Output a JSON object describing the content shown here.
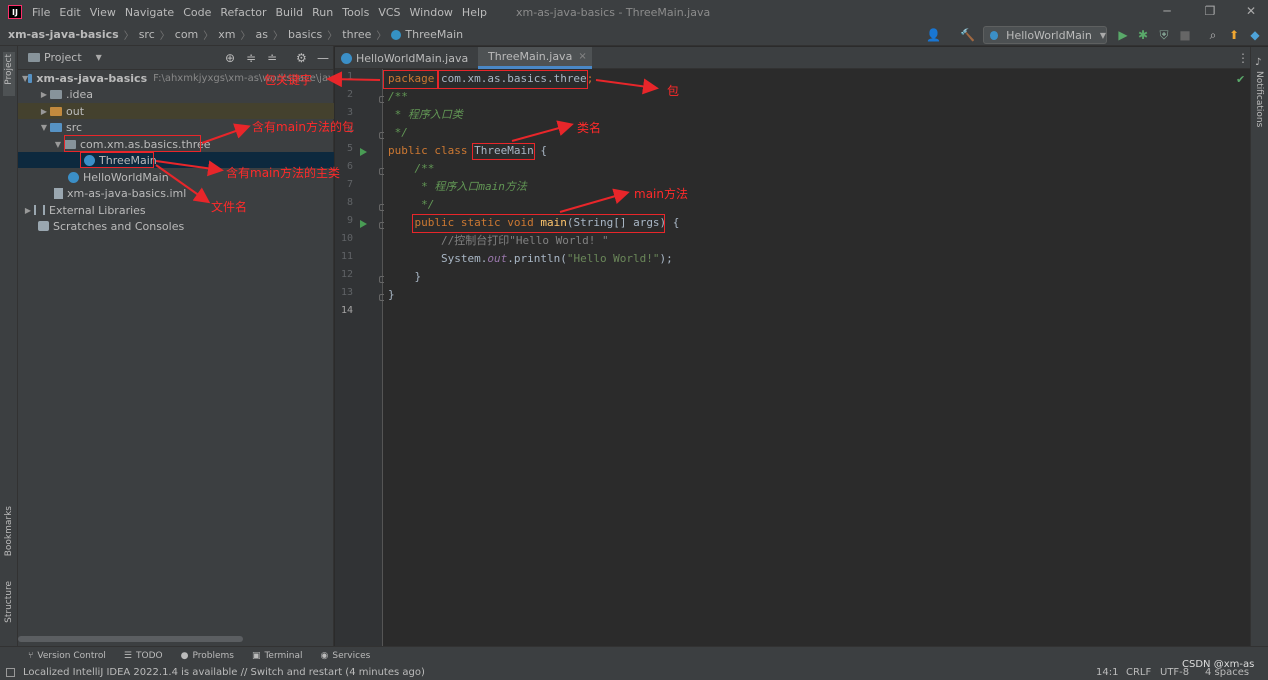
{
  "app": {
    "menu": [
      "File",
      "Edit",
      "View",
      "Navigate",
      "Code",
      "Refactor",
      "Build",
      "Run",
      "Tools",
      "VCS",
      "Window",
      "Help"
    ],
    "window_title": "xm-as-java-basics - ThreeMain.java",
    "logo_text": "IJ"
  },
  "breadcrumb": [
    "xm-as-java-basics",
    "src",
    "com",
    "xm",
    "as",
    "basics",
    "three",
    "ThreeMain"
  ],
  "toolbar": {
    "run_config": "HelloWorldMain",
    "run_config_arrow": "▼"
  },
  "project_panel": {
    "title": "Project",
    "title_arrow": "▼",
    "tree": [
      {
        "label": "xm-as-java-basics",
        "extra": "F:\\ahxmkjyxgs\\xm-as\\workspace\\jav",
        "indent": 0,
        "arrow": "▼",
        "icon": "module-folder",
        "bold": true
      },
      {
        "label": ".idea",
        "indent": 1,
        "arrow": "▶",
        "icon": "folder"
      },
      {
        "label": "out",
        "indent": 1,
        "arrow": "▶",
        "icon": "folder-orange",
        "highlight": "out"
      },
      {
        "label": "src",
        "indent": 1,
        "arrow": "▼",
        "icon": "folder-blue"
      },
      {
        "label": "com.xm.as.basics.three",
        "indent": 2,
        "arrow": "▼",
        "icon": "package"
      },
      {
        "label": "ThreeMain",
        "indent": 3,
        "arrow": "",
        "icon": "class",
        "highlight": "sel"
      },
      {
        "label": "HelloWorldMain",
        "indent": 2,
        "arrow": "",
        "icon": "class"
      },
      {
        "label": "xm-as-java-basics.iml",
        "indent": 1,
        "arrow": "",
        "icon": "iml-file"
      },
      {
        "label": "External Libraries",
        "indent": 0,
        "arrow": "▶",
        "icon": "libraries"
      },
      {
        "label": "Scratches and Consoles",
        "indent": 0,
        "arrow": "",
        "icon": "scratches"
      }
    ]
  },
  "left_strip": {
    "project": "Project",
    "bookmarks": "Bookmarks",
    "structure": "Structure"
  },
  "right_strip": {
    "notifications": "Notifications"
  },
  "tabs": [
    {
      "label": "HelloWorldMain.java",
      "active": false
    },
    {
      "label": "ThreeMain.java",
      "active": true
    }
  ],
  "tab_close": "×",
  "line_numbers": [
    "1",
    "2",
    "3",
    "4",
    "5",
    "6",
    "7",
    "8",
    "9",
    "10",
    "11",
    "12",
    "13",
    "14"
  ],
  "code": {
    "l1_kw": "package",
    "l1_pkg": "com.xm.as.basics.three",
    "l1_end": ";",
    "l2": "/**",
    "l3": " * 程序入口类",
    "l4": " */",
    "l5_kw": "public class ",
    "l5_name": "ThreeMain",
    "l5_end": " {",
    "l6": "    /**",
    "l7": "     * 程序入口main方法",
    "l8": "     */",
    "l9_kw": "public static void ",
    "l9_fn": "main",
    "l9_args": "(String[] args)",
    "l9_end": " {",
    "l10": "        //控制台打印\"Hello World! \"",
    "l11_a": "        System.",
    "l11_field": "out",
    "l11_b": ".println(",
    "l11_str": "\"Hello World!\"",
    "l11_c": ");",
    "l12": "    }",
    "l13": "}"
  },
  "bottom_tools": [
    {
      "label": "Version Control",
      "icon": "branch-icon"
    },
    {
      "label": "TODO",
      "icon": "list-icon"
    },
    {
      "label": "Problems",
      "icon": "info-icon"
    },
    {
      "label": "Terminal",
      "icon": "terminal-icon"
    },
    {
      "label": "Services",
      "icon": "services-icon"
    }
  ],
  "status": {
    "message": "Localized IntelliJ IDEA 2022.1.4 is available // Switch and restart (4 minutes ago)",
    "position": "14:1",
    "line_sep": "CRLF",
    "encoding": "UTF-8",
    "indent": "4 spaces",
    "watermark": "CSDN @xm-as"
  },
  "annotations": {
    "keyword": "包关键字",
    "package": "包",
    "main_package": "含有main方法的包",
    "main_class": "含有main方法的主类",
    "filename": "文件名",
    "classname": "类名",
    "main_method": "main方法"
  },
  "colors": {
    "annotation_red": "#e8262a",
    "run_green": "#499c54",
    "selection": "#0d293e",
    "keyword": "#cc7832"
  }
}
